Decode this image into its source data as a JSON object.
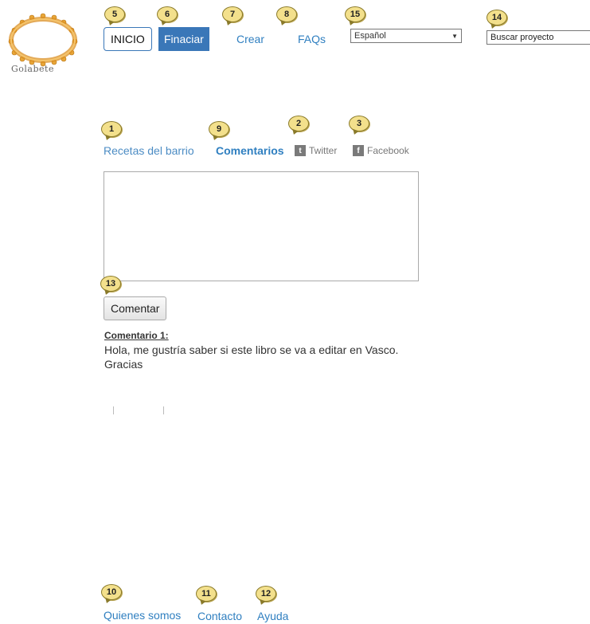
{
  "logo": {
    "text": "Golabete",
    "icon": "people-circle-logo"
  },
  "nav": {
    "inicio": "INICIO",
    "financiar": "Finaciar",
    "crear": "Crear",
    "faqs": "FAQs",
    "language": "Español",
    "search_value": "Buscar proyecto"
  },
  "tabs": {
    "recetas": "Recetas del barrio",
    "comentarios": "Comentarios",
    "twitter": "Twitter",
    "facebook": "Facebook"
  },
  "comment_form": {
    "textarea_value": "",
    "button_label": "Comentar"
  },
  "comment": {
    "title": "Comentario 1:",
    "body": "Hola, me gustría saber si este libro se va a editar en Vasco. Gracias"
  },
  "footer": {
    "quienes": "Quienes somos",
    "contacto": "Contacto",
    "ayuda": "Ayuda"
  },
  "badges": {
    "b1": "1",
    "b2": "2",
    "b3": "3",
    "b5": "5",
    "b6": "6",
    "b7": "7",
    "b8": "8",
    "b9": "9",
    "b10": "10",
    "b11": "11",
    "b12": "12",
    "b13": "13",
    "b14": "14",
    "b15": "15"
  },
  "colors": {
    "accent": "#3a77b8",
    "link": "#2f7fc0",
    "badge": "#f3e08c"
  }
}
